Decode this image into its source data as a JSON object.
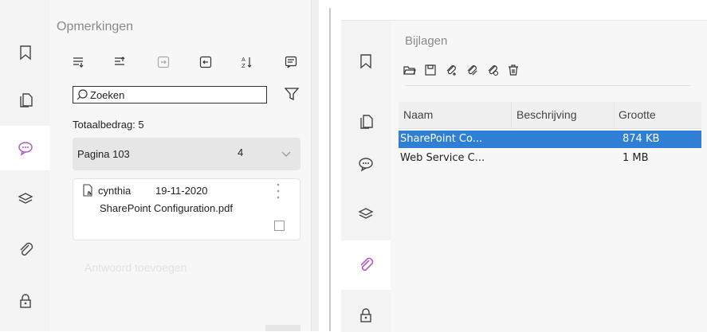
{
  "left_panel": {
    "title": "Opmerkingen",
    "toolbar_icons": [
      "expand-all-icon",
      "collapse-all-icon",
      "import-icon",
      "export-icon",
      "sort-icon",
      "note-icon"
    ],
    "search": {
      "placeholder": "Zoeken"
    },
    "total_label": "Totaalbedrag: 5",
    "page_group": {
      "label": "Pagina 103",
      "count": "4"
    },
    "comment": {
      "author": "cynthia",
      "date": "19-11-2020",
      "file": "SharePoint Configuration.pdf"
    },
    "reply_placeholder": "Antwoord toevoegen"
  },
  "sidebar_icons": [
    "bookmark-icon",
    "pages-icon",
    "comments-icon",
    "layers-icon",
    "attachments-icon",
    "security-icon"
  ],
  "right_panel": {
    "title": "Bijlagen",
    "toolbar_icons": [
      "open-icon",
      "save-icon",
      "add-attachment-icon",
      "edit-attachment-icon",
      "attach-files-icon",
      "delete-icon"
    ],
    "columns": [
      "Naam",
      "Beschrijving",
      "Grootte"
    ],
    "rows": [
      {
        "name": "SharePoint Co...",
        "description": "",
        "size": "874 KB",
        "selected": true
      },
      {
        "name": "Web Service C...",
        "description": "",
        "size": "1 MB",
        "selected": false
      }
    ]
  },
  "colors": {
    "accent": "#b05cc8",
    "selection": "#2f7fd4"
  }
}
